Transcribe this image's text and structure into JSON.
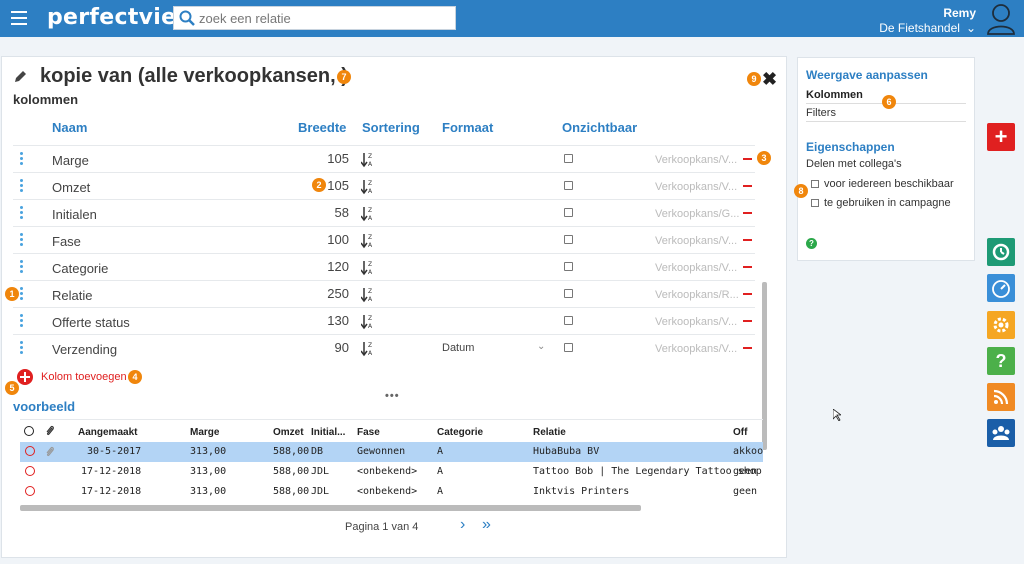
{
  "header": {
    "logo": "perfectview",
    "search_placeholder": "zoek een relatie",
    "user_name": "Remy",
    "user_org": "De Fietshandel"
  },
  "main": {
    "title": "kopie van (alle verkoopkansen, )",
    "section_columns": "kolommen",
    "column_headers": {
      "name": "Naam",
      "width": "Breedte",
      "sort": "Sortering",
      "format": "Formaat",
      "hidden": "Onzichtbaar"
    },
    "rows": [
      {
        "name": "Marge",
        "width": "105",
        "format": "",
        "path": "Verkoopkans/V..."
      },
      {
        "name": "Omzet",
        "width": "105",
        "format": "",
        "path": "Verkoopkans/V..."
      },
      {
        "name": "Initialen",
        "width": "58",
        "format": "",
        "path": "Verkoopkans/G..."
      },
      {
        "name": "Fase",
        "width": "100",
        "format": "",
        "path": "Verkoopkans/V..."
      },
      {
        "name": "Categorie",
        "width": "120",
        "format": "",
        "path": "Verkoopkans/V..."
      },
      {
        "name": "Relatie",
        "width": "250",
        "format": "",
        "path": "Verkoopkans/R..."
      },
      {
        "name": "Offerte status",
        "width": "130",
        "format": "",
        "path": "Verkoopkans/V..."
      },
      {
        "name": "Verzending",
        "width": "90",
        "format": "Datum",
        "path": "Verkoopkans/V..."
      }
    ],
    "add_column": "Kolom toevoegen",
    "section_preview": "voorbeeld",
    "preview_headers": [
      "Aangemaakt",
      "Marge",
      "Omzet",
      "Initial...",
      "Fase",
      "Categorie",
      "Relatie",
      "Off"
    ],
    "preview_rows": [
      {
        "date": "30-5-2017",
        "marge": "313,00",
        "omzet": "588,00",
        "init": "DB",
        "fase": "Gewonnen",
        "cat": "A",
        "relatie": "HubaBuba BV",
        "off": "akkoo"
      },
      {
        "date": "17-12-2018",
        "marge": "313,00",
        "omzet": "588,00",
        "init": "JDL",
        "fase": "<onbekend>",
        "cat": "A",
        "relatie": "Tattoo Bob | The Legendary Tattoo shop",
        "off": "geen c"
      },
      {
        "date": "17-12-2018",
        "marge": "313,00",
        "omzet": "588,00",
        "init": "JDL",
        "fase": "<onbekend>",
        "cat": "A",
        "relatie": "Inktvis Printers",
        "off": "geen c"
      }
    ],
    "pager": "Pagina 1 van 4"
  },
  "right_panel": {
    "title": "Weergave aanpassen",
    "tab_columns": "Kolommen",
    "tab_filters": "Filters",
    "properties_title": "Eigenschappen",
    "share_label": "Delen met collega's",
    "opt_everyone": "voor iedereen beschikbaar",
    "opt_campaign": "te gebruiken in campagne"
  },
  "badges": [
    "1",
    "2",
    "3",
    "4",
    "5",
    "6",
    "7",
    "8",
    "9"
  ],
  "colors": {
    "brand": "#2d7fc3",
    "danger": "#e02020",
    "badge": "#f0860c",
    "green": "#1e9a75"
  }
}
